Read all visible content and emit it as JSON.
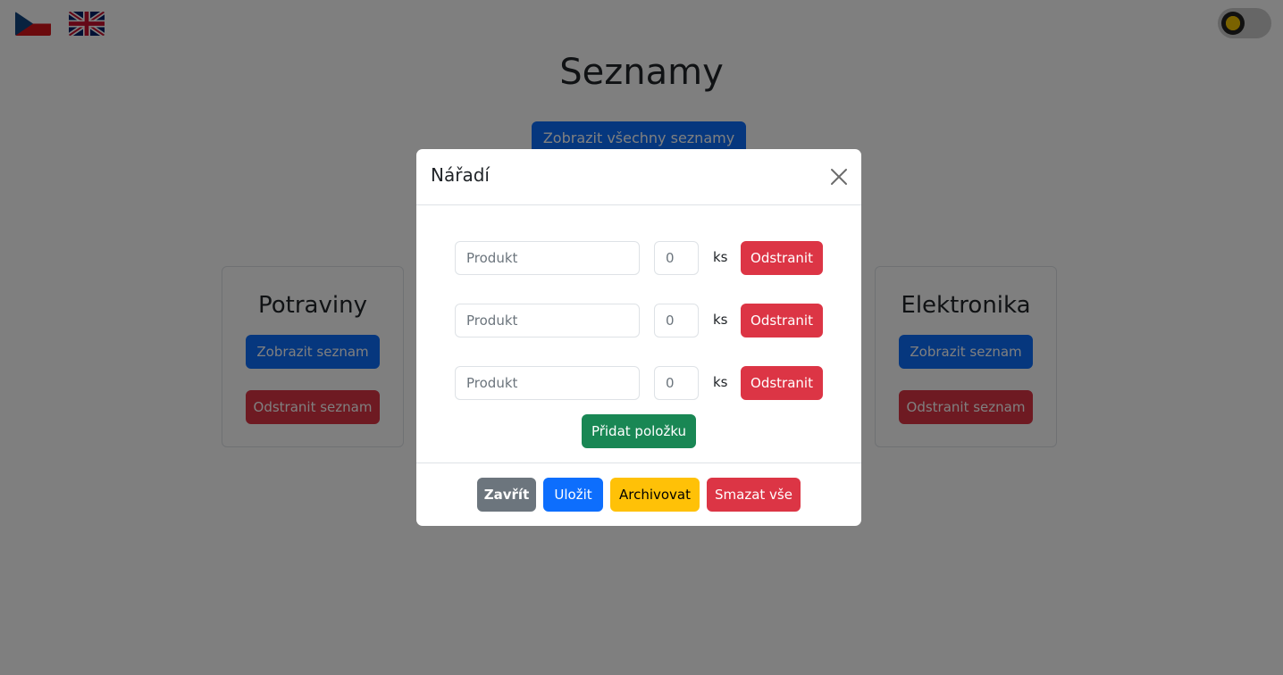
{
  "header": {
    "languages": [
      {
        "code": "cs",
        "icon": "czech-flag-icon"
      },
      {
        "code": "en",
        "icon": "uk-flag-icon"
      }
    ],
    "theme_toggle": {
      "state": "dark-mode-off",
      "icon": "sun-icon"
    }
  },
  "page": {
    "title": "Seznamy",
    "show_all_label": "Zobrazit všechny seznamy"
  },
  "lists": [
    {
      "title": "Potraviny",
      "show_label": "Zobrazit seznam",
      "delete_label": "Odstranit seznam"
    },
    {
      "title": "Elektronika",
      "show_label": "Zobrazit seznam",
      "delete_label": "Odstranit seznam"
    }
  ],
  "modal": {
    "title": "Nářadí",
    "items": [
      {
        "product_placeholder": "Produkt",
        "product_value": "",
        "quantity": "0",
        "unit": "ks",
        "remove_label": "Odstranit"
      },
      {
        "product_placeholder": "Produkt",
        "product_value": "",
        "quantity": "0",
        "unit": "ks",
        "remove_label": "Odstranit"
      },
      {
        "product_placeholder": "Produkt",
        "product_value": "",
        "quantity": "0",
        "unit": "ks",
        "remove_label": "Odstranit"
      }
    ],
    "add_item_label": "Přidat položku",
    "footer": {
      "close_label": "Zavřít",
      "save_label": "Uložit",
      "archive_label": "Archivovat",
      "delete_all_label": "Smazat vše"
    }
  },
  "colors": {
    "primary": "#0d6efd",
    "danger": "#dc3545",
    "success": "#198754",
    "secondary": "#6c757d",
    "warning": "#ffc107",
    "backdrop": "rgba(0,0,0,0.5)"
  }
}
